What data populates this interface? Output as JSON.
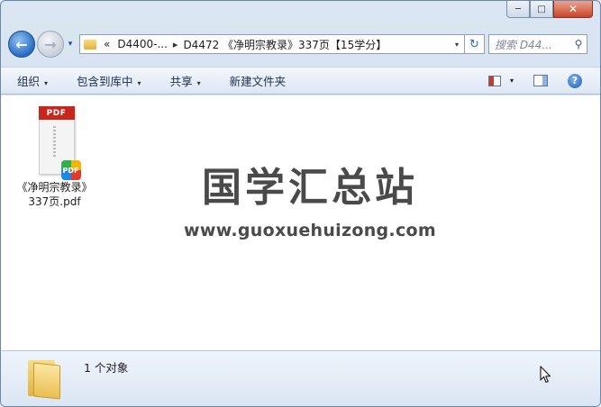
{
  "window": {
    "caption": {
      "minimize": "─",
      "maximize": "□",
      "close": "✕"
    }
  },
  "nav": {
    "back_glyph": "←",
    "forward_glyph": "→",
    "history_glyph": "▾",
    "breadcrumb_prefix": "«",
    "breadcrumbs": [
      "D4400-...",
      "D4472 《净明宗教录》337页【15学分】"
    ],
    "separator": "▸",
    "dropdown_glyph": "▾",
    "refresh_glyph": "↻",
    "search_placeholder": "搜索 D44...",
    "search_glyph": "⚲"
  },
  "commandbar": {
    "items": [
      "组织",
      "包含到库中",
      "共享",
      "新建文件夹"
    ],
    "dropdown_glyph": "▾",
    "help_glyph": "?"
  },
  "content": {
    "file": {
      "type_badge": "PDF",
      "corner_badge": "PDF",
      "name_line1": "《净明宗教录》",
      "name_line2": "337页.pdf"
    },
    "watermark": {
      "title": "国学汇总站",
      "url": "www.guoxuehuizong.com"
    }
  },
  "status": {
    "text": "1 个对象"
  },
  "colors": {
    "accent": "#2a6cc2",
    "pdf_red": "#c8261b",
    "close_red": "#c8452a"
  }
}
